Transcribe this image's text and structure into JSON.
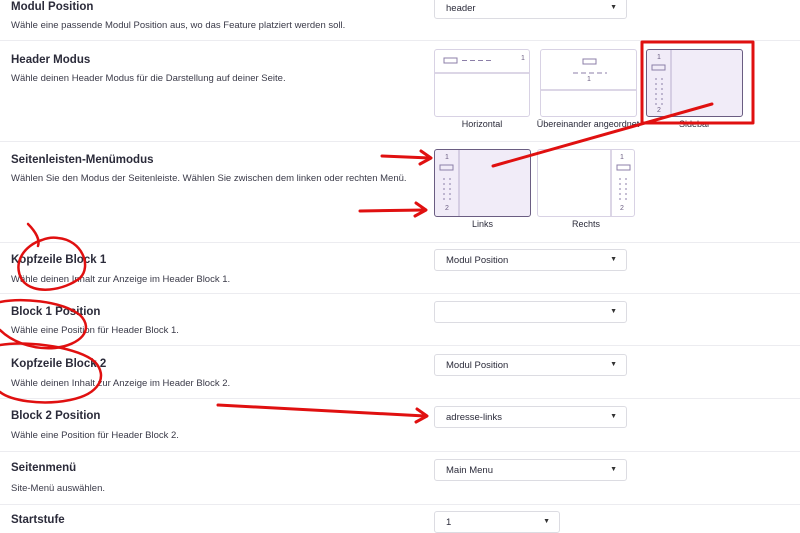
{
  "rows": {
    "modul_position": {
      "label": "Modul Position",
      "description": "Wähle eine passende Modul Position aus, wo das Feature platziert werden soll.",
      "value": "header"
    },
    "header_modus": {
      "label": "Header Modus",
      "description": "Wähle deinen Header Modus für die Darstellung auf deiner Seite.",
      "options": [
        {
          "caption": "Horizontal",
          "num1": "1"
        },
        {
          "caption": "Übereinander angeordnet",
          "num1": "1"
        },
        {
          "caption": "Sidebar",
          "num1": "1",
          "num2": "2"
        }
      ],
      "selected": "Sidebar"
    },
    "seitenleisten": {
      "label": "Seitenleisten-Menümodus",
      "description": "Wählen Sie den Modus der Seitenleiste. Wählen Sie zwischen dem linken oder rechten Menü.",
      "options": [
        {
          "caption": "Links",
          "num1": "1",
          "num2": "2"
        },
        {
          "caption": "Rechts",
          "num1": "1",
          "num2": "2"
        }
      ],
      "selected": "Links"
    },
    "kopfzeile_block1": {
      "label": "Kopfzeile Block 1",
      "description": "Wähle deinen Inhalt zur Anzeige im Header Block 1.",
      "value": "Modul Position"
    },
    "block1_position": {
      "label": "Block 1 Position",
      "description": "Wähle eine Position für Header Block 1.",
      "value": ""
    },
    "kopfzeile_block2": {
      "label": "Kopfzeile Block 2",
      "description": "Wähle deinen Inhalt zur Anzeige im Header Block 2.",
      "value": "Modul Position"
    },
    "block2_position": {
      "label": "Block 2 Position",
      "description": "Wähle eine Position für Header Block 2.",
      "value": "adresse-links"
    },
    "seitenmenu": {
      "label": "Seitenmenü",
      "description": "Site-Menü auswählen.",
      "value": "Main Menu"
    },
    "startstufe": {
      "label": "Startstufe",
      "value": "1"
    }
  },
  "icons": {
    "dropdown": "chevron-down-icon"
  },
  "colors": {
    "accent": "#6a5d82",
    "card_border": "#d8d2e4",
    "active_bg": "#f1ecf8",
    "annotation": "#e01010"
  }
}
